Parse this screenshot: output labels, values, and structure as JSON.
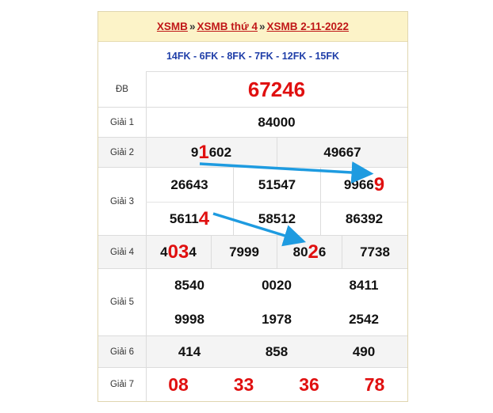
{
  "breadcrumb": {
    "items": [
      "XSMB",
      "XSMB thứ 4",
      "XSMB 2-11-2022"
    ],
    "separator": "»"
  },
  "codes": "14FK - 6FK - 8FK - 7FK - 12FK - 15FK",
  "prizes": {
    "db": {
      "label": "ĐB",
      "value": "67246"
    },
    "g1": {
      "label": "Giải 1",
      "value": "84000"
    },
    "g2": {
      "label": "Giải 2",
      "values": [
        {
          "pre": "9",
          "hl": "1",
          "post": "602"
        },
        "49667"
      ]
    },
    "g3": {
      "label": "Giải 3",
      "values": [
        "26643",
        "51547",
        {
          "pre": "9966",
          "hl": "9"
        },
        {
          "pre": "5611",
          "hl": "4"
        },
        "58512",
        "86392"
      ]
    },
    "g4": {
      "label": "Giải 4",
      "values": [
        {
          "pre": "4",
          "hl": "03",
          "post": "4"
        },
        "7999",
        {
          "pre": "80",
          "hl": "2",
          "post": "6"
        },
        "7738"
      ]
    },
    "g5": {
      "label": "Giải 5",
      "values": [
        "8540",
        "0020",
        "8411",
        "9998",
        "1978",
        "2542"
      ]
    },
    "g6": {
      "label": "Giải 6",
      "values": [
        "414",
        "858",
        "490"
      ]
    },
    "g7": {
      "label": "Giải 7",
      "values": [
        "08",
        "33",
        "36",
        "78"
      ]
    }
  },
  "colors": {
    "highlight": "#e01010",
    "arrow": "#1e9be0",
    "header_bg": "#fcf3c8",
    "codes": "#1f3ea8"
  }
}
